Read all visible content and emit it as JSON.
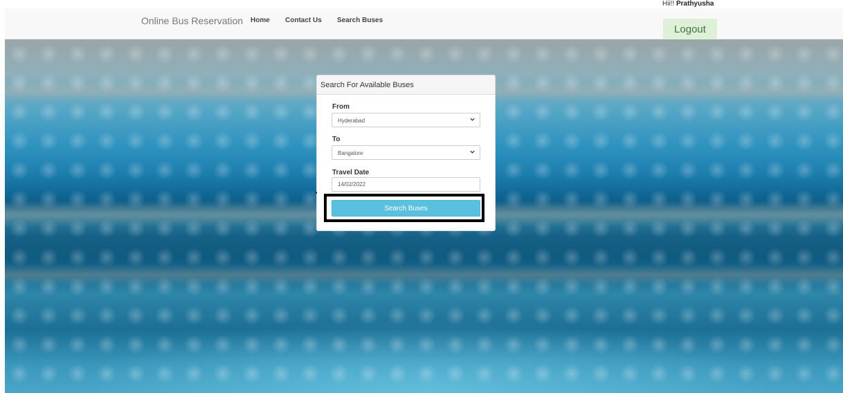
{
  "navbar": {
    "brand": "Online Bus Reservation",
    "links": [
      "Home",
      "Contact Us",
      "Search Buses"
    ]
  },
  "user": {
    "greeting_prefix": "Hii!! ",
    "name": "Prathyusha",
    "logout_label": "Logout"
  },
  "search_panel": {
    "title": "Search For Available Buses",
    "from_label": "From",
    "from_value": "Hyderabad",
    "to_label": "To",
    "to_value": "Bangalore",
    "date_label": "Travel Date",
    "date_value": "14/02/2022",
    "submit_label": "Search Buses"
  },
  "colors": {
    "navbar_bg": "#f8f8f8",
    "logout_bg": "#dff0d8",
    "logout_text": "#3c763d",
    "button_info": "#5bc0de",
    "highlight_border": "#000000"
  },
  "icons": {
    "dropdown": "chevron-down-icon"
  }
}
